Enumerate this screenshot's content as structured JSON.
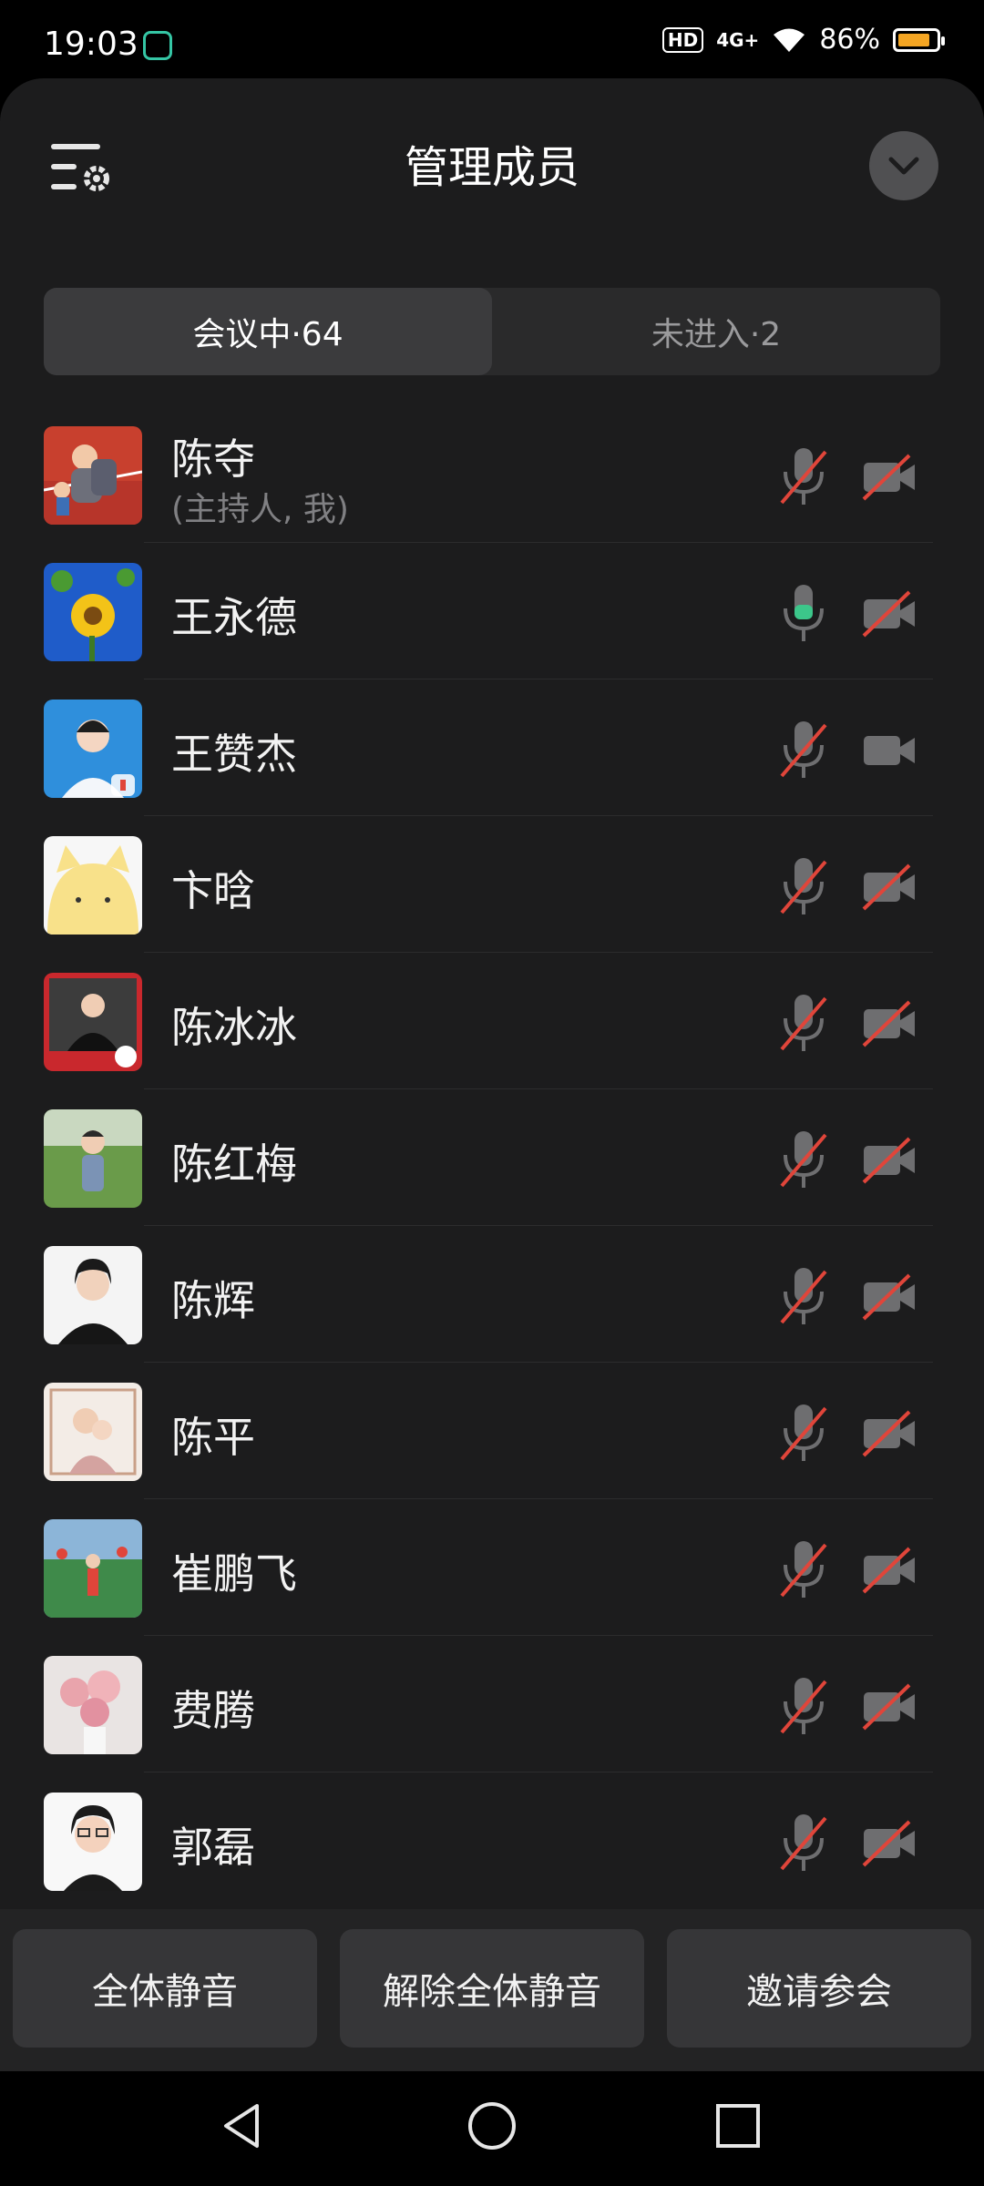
{
  "status_bar": {
    "time": "19:03",
    "hd_badge": "HD",
    "network": "4G+",
    "battery_percent": "86%",
    "battery_level": 0.86
  },
  "header": {
    "title": "管理成员",
    "settings_icon": "list-settings-icon",
    "collapse_icon": "chevron-down-icon"
  },
  "tabs": [
    {
      "label": "会议中·64",
      "active": true
    },
    {
      "label": "未进入·2",
      "active": false
    }
  ],
  "members": [
    {
      "name": "陈夺",
      "role": "(主持人, 我)",
      "mic": "muted",
      "camera": "off"
    },
    {
      "name": "王永德",
      "role": "",
      "mic": "on",
      "camera": "off"
    },
    {
      "name": "王赞杰",
      "role": "",
      "mic": "muted",
      "camera": "on"
    },
    {
      "name": "卞晗",
      "role": "",
      "mic": "muted",
      "camera": "off"
    },
    {
      "name": "陈冰冰",
      "role": "",
      "mic": "muted",
      "camera": "off"
    },
    {
      "name": "陈红梅",
      "role": "",
      "mic": "muted",
      "camera": "off"
    },
    {
      "name": "陈辉",
      "role": "",
      "mic": "muted",
      "camera": "off"
    },
    {
      "name": "陈平",
      "role": "",
      "mic": "muted",
      "camera": "off"
    },
    {
      "name": "崔鹏飞",
      "role": "",
      "mic": "muted",
      "camera": "off"
    },
    {
      "name": "费腾",
      "role": "",
      "mic": "muted",
      "camera": "off"
    },
    {
      "name": "郭磊",
      "role": "",
      "mic": "muted",
      "camera": "off"
    }
  ],
  "actions": {
    "mute_all": "全体静音",
    "unmute_all": "解除全体静音",
    "invite": "邀请参会"
  },
  "nav": {
    "back_icon": "triangle-back-icon",
    "home_icon": "circle-home-icon",
    "recents_icon": "square-recents-icon"
  },
  "colors": {
    "sheet_bg": "#1c1c1d",
    "muted_red": "#e0453a",
    "mic_on_green": "#3cc68a",
    "battery": "#f5a623"
  }
}
